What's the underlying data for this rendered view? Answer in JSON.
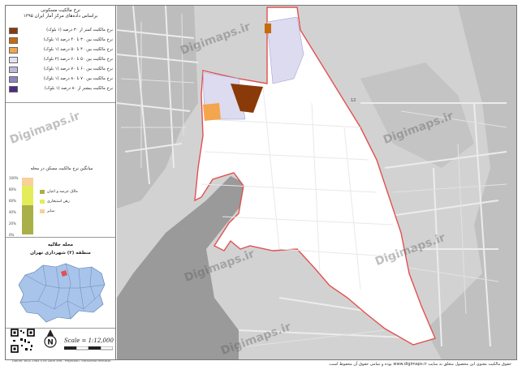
{
  "legend": {
    "title_line1": "نرخ مالکیت مسکونی",
    "title_line2": "براساس داده‌های مرکز آمار ایران ۱۳۹۵",
    "items": [
      {
        "label": "نرخ مالکیت کمتر از ۳۰ درصد (۱ بلوک)",
        "color": "#8a3a08"
      },
      {
        "label": "نرخ مالکیت بین ۳۰ تا ۴۰ درصد (۱ بلوک)",
        "color": "#c8690d"
      },
      {
        "label": "نرخ مالکیت بین ۴۰ تا ۵۰ درصد (۱ بلوک)",
        "color": "#f3a64d"
      },
      {
        "label": "نرخ مالکیت بین ۵۰ تا ۶۰ درصد (۲ بلوک)",
        "color": "#e3e2f1"
      },
      {
        "label": "نرخ مالکیت بین ۶۰ تا ۷۰ درصد (۱ بلوک)",
        "color": "#bcb9dc"
      },
      {
        "label": "نرخ مالکیت بین ۷۰ تا ۸۰ درصد (۱ بلوک)",
        "color": "#8d85c0"
      },
      {
        "label": "نرخ مالکیت بیشتر از ۸۰ درصد (۱ بلوک)",
        "color": "#4e2a84"
      }
    ]
  },
  "chart": {
    "title": "میانگین نرخ مالکیت مسکن در محله",
    "ticks": [
      "100%",
      "80%",
      "60%",
      "40%",
      "20%",
      "0%"
    ],
    "segments": [
      {
        "label": "مالک عرصه و اعیان",
        "color": "#a9b04a",
        "share": 0.52
      },
      {
        "label": "رهن استیجاری",
        "color": "#e4ec5a",
        "share": 0.34
      },
      {
        "label": "سایر",
        "color": "#f7d09a",
        "share": 0.14
      }
    ]
  },
  "location": {
    "title_line1": "محله جلالیه",
    "title_line2": "منطقه (۲) شهرداری تهران"
  },
  "scale": "Scale = 1:12,000",
  "north_letter": "N",
  "footer_note": "Datum: WGS 1984 UTM Zone 39N - Projection: Transverse Mercator",
  "watermark": "Digimaps.ir",
  "copyright": "حقوق مالکیت معنوی این محصول متعلق به سایت www.digimaps.ir بوده و تمامی حقوق آن محفوظ است.",
  "map_label": "12"
}
